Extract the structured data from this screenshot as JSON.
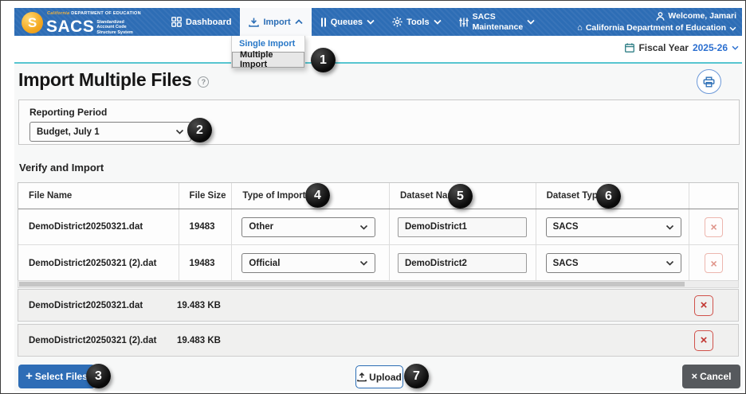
{
  "colors": {
    "nav_blue": "#2d6db5",
    "link_blue": "#2a6db5",
    "teal_line": "#57c5d0",
    "badge_black": "#0a0a0a",
    "danger_red": "#c23530",
    "cancel_gray": "#56595d",
    "select_files_blue": "#2e6db6"
  },
  "icons": {
    "logo_mark": "S",
    "plus": "+",
    "close_x": "×",
    "help": "?",
    "home": "⌂"
  },
  "header": {
    "logo": {
      "tagline_brand": "California",
      "tagline_rest": "DEPARTMENT OF EDUCATION",
      "acronym": "SACS",
      "subtitle1": "Standardized",
      "subtitle2": "Account Code",
      "subtitle3": "Structure System"
    },
    "nav": {
      "dashboard": "Dashboard",
      "import": "Import",
      "queues": "Queues",
      "tools": "Tools",
      "maintenance1": "SACS",
      "maintenance2": "Maintenance"
    },
    "user": {
      "welcome": "Welcome, Jamari",
      "org": "California Department of Education"
    }
  },
  "import_menu": {
    "single": "Single Import",
    "multiple": "Multiple Import"
  },
  "fiscal": {
    "label": "Fiscal Year",
    "value": "2025-26"
  },
  "page": {
    "title": "Import Multiple Files"
  },
  "reporting": {
    "label": "Reporting Period",
    "value": "Budget, July 1"
  },
  "verify": {
    "heading": "Verify and Import",
    "col_file_name": "File Name",
    "col_file_size": "File Size",
    "col_type": "Type of Import",
    "col_dataset_name": "Dataset Name",
    "col_dataset_type": "Dataset Type",
    "rows": [
      {
        "file_name": "DemoDistrict20250321.dat",
        "file_size": "19483",
        "type_of_import": "Other",
        "dataset_name": "DemoDistrict1",
        "dataset_type": "SACS"
      },
      {
        "file_name": "DemoDistrict20250321 (2).dat",
        "file_size": "19483",
        "type_of_import": "Official",
        "dataset_name": "DemoDistrict2",
        "dataset_type": "SACS"
      }
    ]
  },
  "files": [
    {
      "file_name": "DemoDistrict20250321.dat",
      "file_size": "19.483 KB"
    },
    {
      "file_name": "DemoDistrict20250321 (2).dat",
      "file_size": "19.483 KB"
    }
  ],
  "buttons": {
    "select_files": "Select Files",
    "upload": "Upload",
    "cancel": "Cancel"
  },
  "badges": {
    "b1": "1",
    "b2": "2",
    "b3": "3",
    "b4": "4",
    "b5": "5",
    "b6": "6",
    "b7": "7"
  }
}
